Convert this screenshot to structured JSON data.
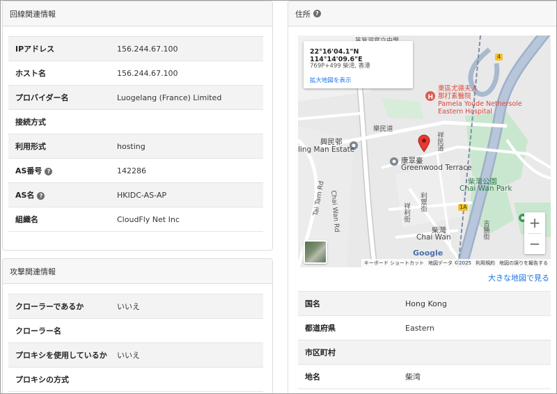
{
  "line_info": {
    "title": "回線関連情報",
    "rows": [
      {
        "label": "IPアドレス",
        "value": "156.244.67.100"
      },
      {
        "label": "ホスト名",
        "value": "156.244.67.100"
      },
      {
        "label": "プロバイダー名",
        "value": "Luogelang (France) Limited"
      },
      {
        "label": "接続方式",
        "value": ""
      },
      {
        "label": "利用形式",
        "value": "hosting"
      },
      {
        "label": "AS番号",
        "value": "142286",
        "help": true
      },
      {
        "label": "AS名",
        "value": "HKIDC-AS-AP",
        "help": true
      },
      {
        "label": "組織名",
        "value": "CloudFly Net Inc"
      }
    ]
  },
  "attack_info": {
    "title": "攻撃関連情報",
    "rows": [
      {
        "label": "クローラーであるか",
        "value": "いいえ"
      },
      {
        "label": "クローラー名",
        "value": ""
      },
      {
        "label": "プロキシを使用しているか",
        "value": "いいえ"
      },
      {
        "label": "プロキシの方式",
        "value": ""
      }
    ]
  },
  "address": {
    "title": "住所",
    "map": {
      "coords": "22°16'04.1\"N 114°14'09.6\"E",
      "plus_code": "769P+499 柴湾, 香港",
      "enlarge_link": "拡大地図を表示",
      "labels": {
        "top_school": "筲箕灣官立中學",
        "hospital_ja": "東區尤德夫人",
        "hospital_ja2": "那打素醫院",
        "hospital_en": "Pamela Youde Nethersole",
        "hospital_en2": "Eastern Hospital",
        "road_chaiwan": "Chai Wan Rd",
        "road_taitam": "Tai Tam Rd",
        "estate_cn": "興民邨",
        "estate_en": "ling Man Estate",
        "terrace_cn": "康翠臺",
        "terrace_en": "Greenwood Terrace",
        "park_cn": "柴灣公園",
        "park_en": "Chai Wan Park",
        "chaiwan_cn": "柴灣",
        "chaiwan_en": "Chai Wan",
        "street1": "樂民道",
        "street2": "祥民道",
        "street3": "利眾街",
        "street4": "祥利街",
        "street5": "吉勝街",
        "route_num": "4",
        "route_1a": "1A",
        "google": "Google",
        "attr_keyboard": "キーボード ショートカット",
        "attr_data": "地図データ ©2025",
        "attr_terms": "利用規約",
        "attr_report": "地図の誤りを報告する"
      },
      "zoom_in": "+",
      "zoom_out": "−"
    },
    "big_map_link": "大きな地図で見る",
    "rows": [
      {
        "label": "国名",
        "value": "Hong Kong"
      },
      {
        "label": "都道府県",
        "value": "Eastern"
      },
      {
        "label": "市区町村",
        "value": ""
      },
      {
        "label": "地名",
        "value": "柴湾"
      }
    ]
  },
  "colors": {
    "link": "#1a73e8",
    "header_bg": "#f7f7f7",
    "stripe": "#f3f3f3",
    "pin": "#e53935"
  }
}
